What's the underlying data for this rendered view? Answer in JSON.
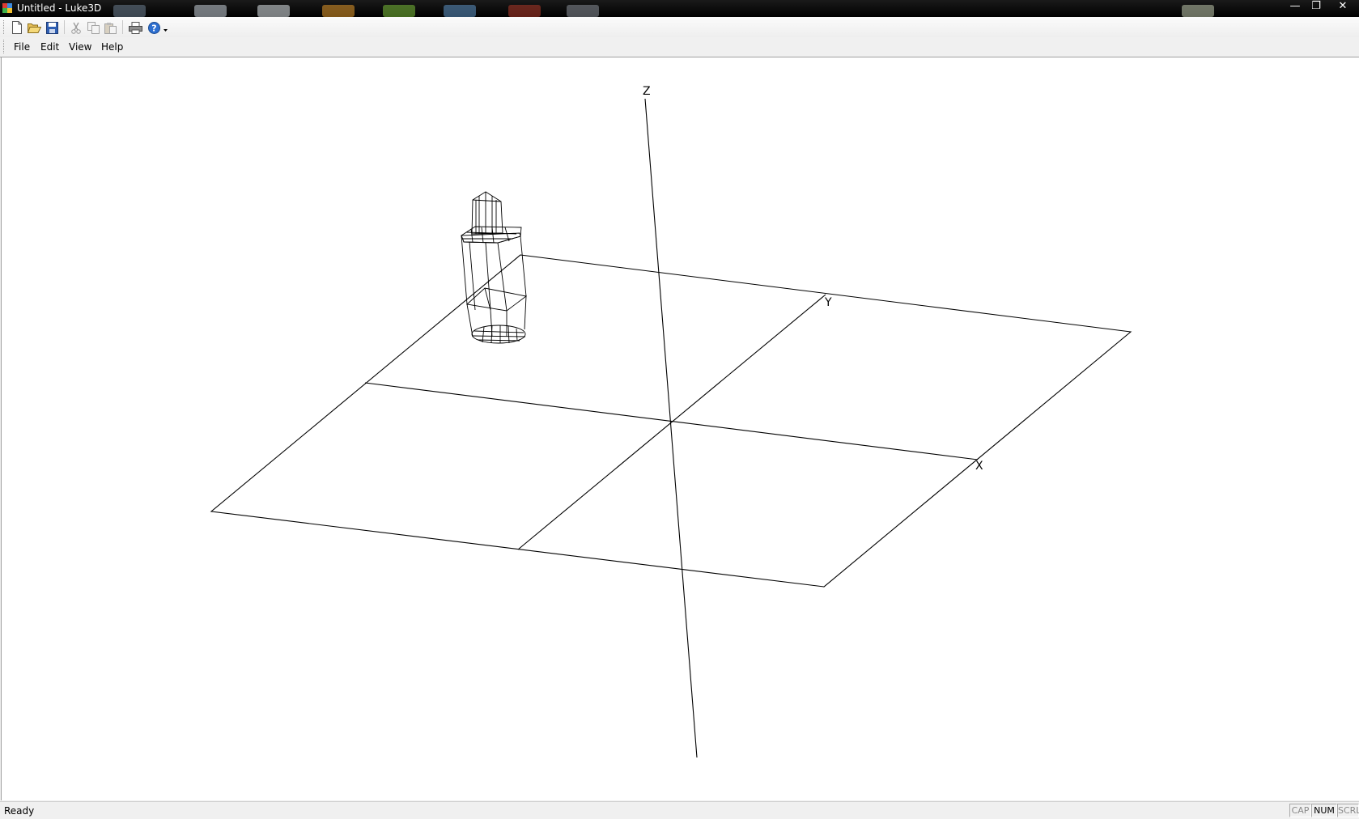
{
  "window": {
    "title": "Untitled - Luke3D",
    "minimize": "—",
    "restore": "❐",
    "close": "✕"
  },
  "toolbar": {
    "buttons": [
      {
        "name": "new-document-icon"
      },
      {
        "name": "open-folder-icon"
      },
      {
        "name": "save-icon"
      },
      {
        "name": "cut-icon"
      },
      {
        "name": "copy-icon"
      },
      {
        "name": "paste-icon"
      },
      {
        "name": "print-icon"
      },
      {
        "name": "help-icon"
      },
      {
        "name": "dropdown-arrow-icon"
      }
    ]
  },
  "menu": {
    "file": "File",
    "edit": "Edit",
    "view": "View",
    "help": "Help"
  },
  "viewport": {
    "axes": {
      "z": "Z",
      "y": "Y",
      "x": "X"
    }
  },
  "status": {
    "text": "Ready",
    "cap": "CAP",
    "num": "NUM",
    "scrl": "SCRL"
  }
}
